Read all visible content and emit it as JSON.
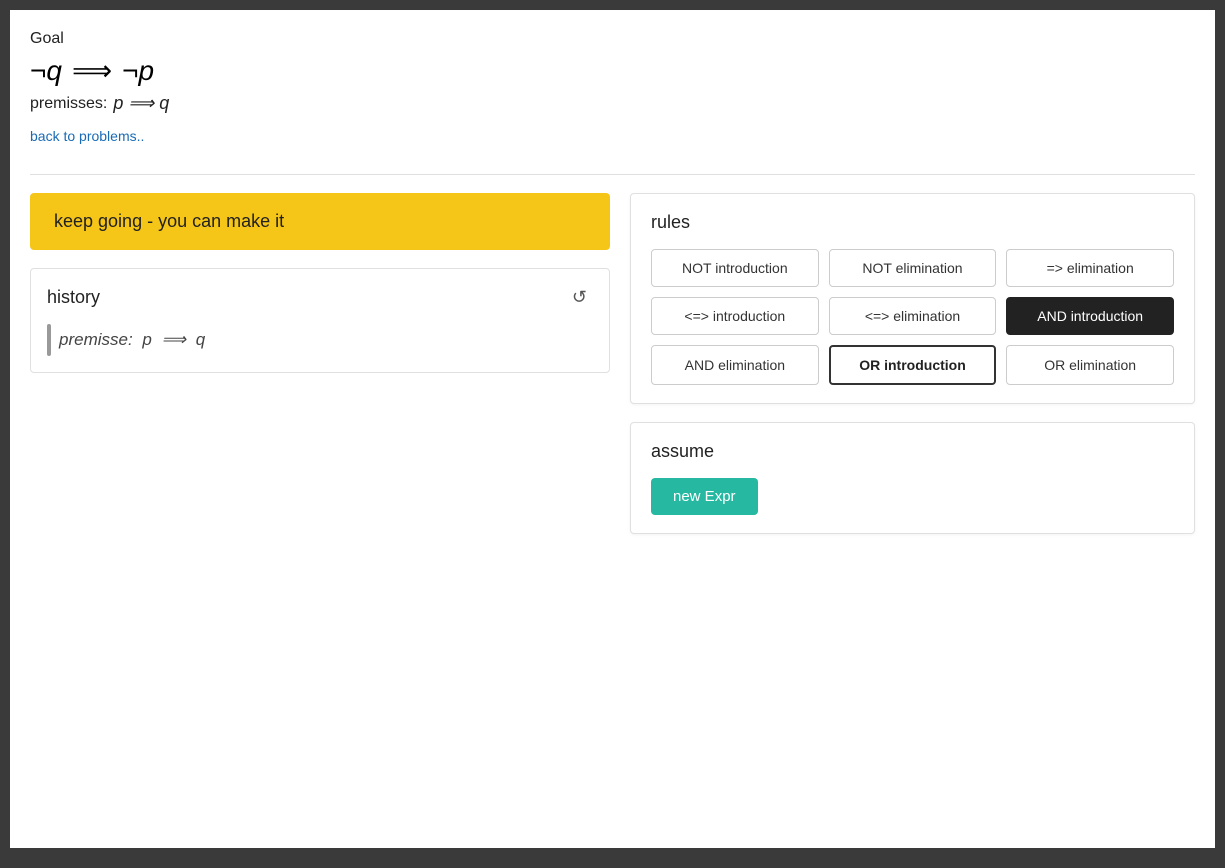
{
  "page": {
    "background": "#3a3a3a"
  },
  "goal": {
    "label": "Goal",
    "formula_display": "¬q ⟹ ¬p",
    "premisses_label": "premisses:",
    "premisses_formula": "p ⟹ q"
  },
  "back_link": {
    "text": "back to problems.."
  },
  "motivation": {
    "text": "keep going - you can make it"
  },
  "history": {
    "label": "history",
    "items": [
      {
        "text": "premisse: p ⟹ q"
      }
    ]
  },
  "rules": {
    "title": "rules",
    "buttons": [
      {
        "id": "not-intro",
        "label": "NOT introduction",
        "state": "normal"
      },
      {
        "id": "not-elim",
        "label": "NOT elimination",
        "state": "normal"
      },
      {
        "id": "impl-elim",
        "label": "=> elimination",
        "state": "normal"
      },
      {
        "id": "iff-intro",
        "label": "<=> introduction",
        "state": "normal"
      },
      {
        "id": "iff-elim",
        "label": "<=> elimination",
        "state": "normal"
      },
      {
        "id": "and-intro",
        "label": "AND introduction",
        "state": "active-and"
      },
      {
        "id": "and-elim",
        "label": "AND elimination",
        "state": "normal"
      },
      {
        "id": "or-intro",
        "label": "OR introduction",
        "state": "active-or"
      },
      {
        "id": "or-elim",
        "label": "OR elimination",
        "state": "normal"
      }
    ]
  },
  "assume": {
    "title": "assume",
    "new_expr_button": "new Expr"
  },
  "icons": {
    "reset": "↺"
  }
}
